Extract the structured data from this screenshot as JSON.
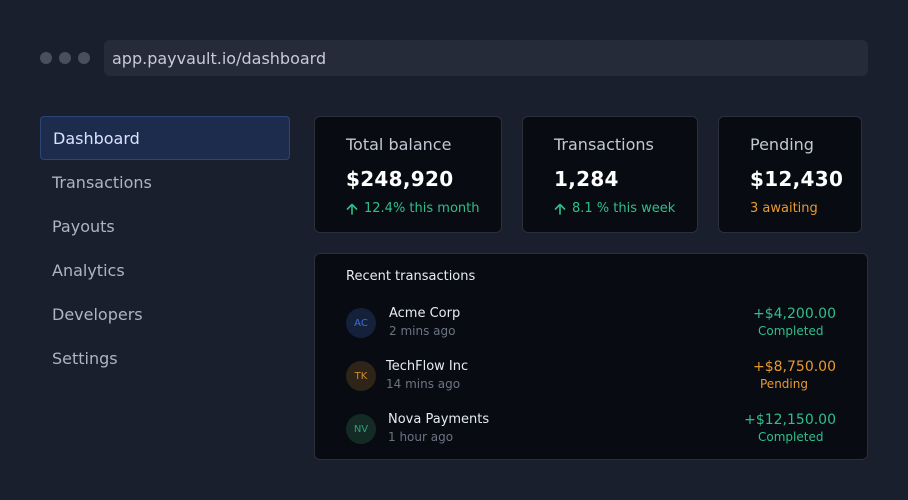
{
  "browser": {
    "url": "app.payvault.io/dashboard"
  },
  "sidebar": {
    "items": [
      {
        "label": "Dashboard",
        "active": true
      },
      {
        "label": "Transactions"
      },
      {
        "label": "Payouts"
      },
      {
        "label": "Analytics"
      },
      {
        "label": "Developers"
      },
      {
        "label": "Settings"
      }
    ]
  },
  "stats": {
    "balance": {
      "label": "Total balance",
      "value": "$248,920",
      "change": "12.4% this month"
    },
    "transactions": {
      "label": "Transactions",
      "value": "1,284",
      "change": "8.1 % this week"
    },
    "pending": {
      "label": "Pending",
      "value": "$12,430",
      "note": "3 awaiting"
    }
  },
  "recent": {
    "title": "Recent transactions",
    "items": [
      {
        "initials": "AC",
        "name": "Acme Corp",
        "time": "2 mins ago",
        "amount": "+$4,200.00",
        "status": "Completed"
      },
      {
        "initials": "TK",
        "name": "TechFlow Inc",
        "time": "14 mins ago",
        "amount": "+$8,750.00",
        "status": "Pending"
      },
      {
        "initials": "NV",
        "name": "Nova Payments",
        "time": "1 hour ago",
        "amount": "+$12,150.00",
        "status": "Completed"
      }
    ]
  },
  "colors": {
    "accent": "#2c4478",
    "positive": "#2fbf8a",
    "pending": "#e8992f",
    "background": "#1a1f2d",
    "card": "#080b12"
  }
}
